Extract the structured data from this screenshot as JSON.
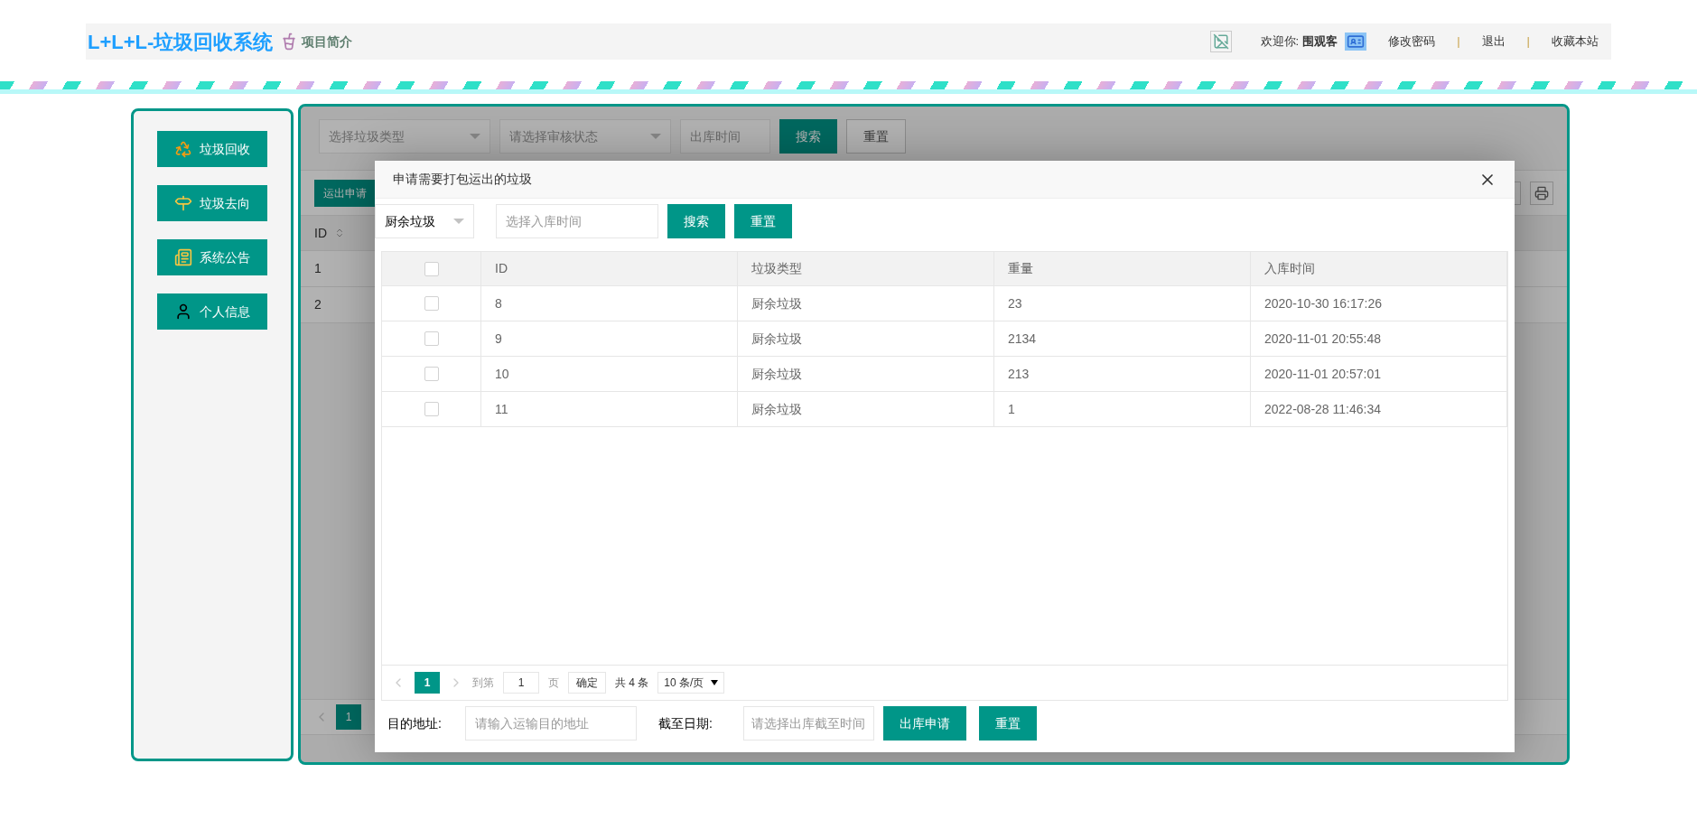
{
  "header": {
    "title": "L+L+L-垃圾回收系统",
    "intro_link": "项目简介",
    "welcome": "欢迎你:",
    "user": "围观客",
    "links": [
      {
        "kind": "link",
        "text": "修改密码"
      },
      {
        "kind": "separator",
        "text": "|"
      },
      {
        "kind": "link",
        "text": "退出"
      },
      {
        "kind": "separator",
        "text": "|"
      },
      {
        "kind": "link",
        "text": "收藏本站"
      }
    ]
  },
  "sidebar": {
    "items": [
      {
        "kind": "recycle",
        "label": "垃圾回收"
      },
      {
        "kind": "signpost",
        "label": "垃圾去向"
      },
      {
        "kind": "notice",
        "label": "系统公告"
      },
      {
        "kind": "user",
        "label": "个人信息"
      }
    ]
  },
  "background": {
    "filters": [
      {
        "kind": "select",
        "placeholder": "选择垃圾类型"
      },
      {
        "kind": "select",
        "placeholder": "请选择审核状态"
      },
      {
        "kind": "input",
        "placeholder": "出库时间"
      }
    ],
    "buttons": [
      "搜索",
      "重置"
    ],
    "toolbar_button": "运出申请",
    "column": "ID",
    "rows": [
      "1",
      "2"
    ],
    "page": "1"
  },
  "modal": {
    "title": "申请需要打包运出的垃圾",
    "type_select": "厨余垃圾",
    "date_placeholder": "选择入库时间",
    "buttons": [
      "搜索",
      "重置"
    ],
    "columns": [
      "ID",
      "垃圾类型",
      "重量",
      "入库时间"
    ],
    "header_checked": false,
    "rows": [
      {
        "checked": false,
        "cells": [
          "8",
          "厨余垃圾",
          "23",
          "2020-10-30 16:17:26"
        ]
      },
      {
        "checked": false,
        "cells": [
          "9",
          "厨余垃圾",
          "2134",
          "2020-11-01 20:55:48"
        ]
      },
      {
        "checked": false,
        "cells": [
          "10",
          "厨余垃圾",
          "213",
          "2020-11-01 20:57:01"
        ]
      },
      {
        "checked": false,
        "cells": [
          "11",
          "厨余垃圾",
          "1",
          "2022-08-28 11:46:34"
        ]
      }
    ],
    "pagination": {
      "current": "1",
      "goto_label": "到第",
      "page_input": "1",
      "page_unit": "页",
      "confirm": "确定",
      "total": "共 4 条",
      "per_page": "10 条/页"
    },
    "form": {
      "address_label": "目的地址:",
      "address_placeholder": "请输入运输目的地址",
      "date_label": "截至日期:",
      "date_placeholder": "请选择出库截至时间",
      "submit": "出库申请",
      "reset": "重置"
    }
  }
}
